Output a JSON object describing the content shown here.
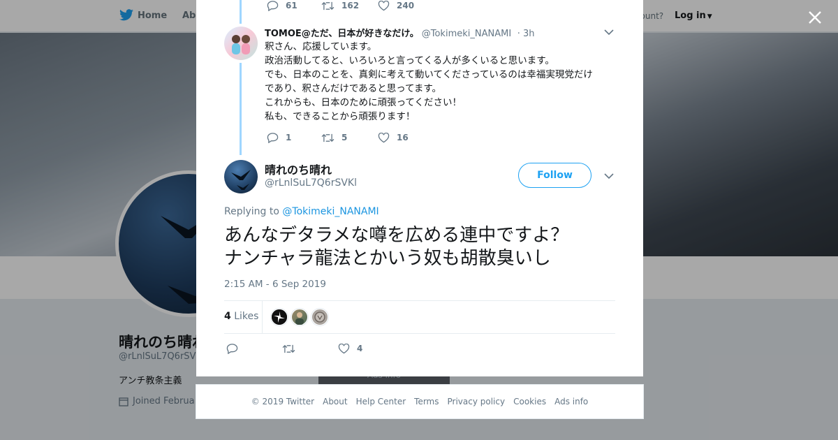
{
  "background": {
    "nav": {
      "home": "Home",
      "about": "Abo",
      "have_account": "account?",
      "login": "Log in"
    },
    "profile": {
      "name": "晴れのち晴れ",
      "handle": "@rLnlSuL7Q6rSV",
      "bio": "アンチ教条主義",
      "joined": "Joined Februa"
    },
    "button_label": "Ads info"
  },
  "thread": {
    "prev_actions": {
      "replies": "61",
      "retweets": "162",
      "likes": "240"
    },
    "reply": {
      "name": "TOMOE@ただ、日本が好きなだけ。",
      "handle": "@Tokimeki_NANAMI",
      "time": "· 3h",
      "lines": [
        "釈さん、応援しています。",
        "政治活動してると、いろいろと言ってくる人が多くいると思います。",
        "でも、日本のことを、真剣に考えて動いてくださっているのは幸福実現党だけ",
        "であり、釈さんだけであると思ってます。",
        "これからも、日本のために頑張ってください！",
        "私も、できることから頑張ります！"
      ],
      "actions": {
        "replies": "1",
        "retweets": "5",
        "likes": "16"
      }
    },
    "main": {
      "name": "晴れのち晴れ",
      "handle": "@rLnlSuL7Q6rSVKl",
      "follow_label": "Follow",
      "replying_prefix": "Replying to",
      "replying_to": "@Tokimeki_NANAMI",
      "text_line1": "あんなデタラメな噂を広める連中ですよ？",
      "text_line2": "ナンチャラ龍法とかいう奴も胡散臭いし",
      "timestamp": "2:15 AM - 6 Sep 2019",
      "likes_count": "4",
      "likes_label": "Likes",
      "actions": {
        "likes": "4"
      }
    }
  },
  "footer": {
    "links": [
      "© 2019 Twitter",
      "About",
      "Help Center",
      "Terms",
      "Privacy policy",
      "Cookies",
      "Ads info"
    ]
  },
  "colors": {
    "accent": "#1da1f2",
    "thread_line": "#9fd6ff",
    "muted": "#657786"
  }
}
